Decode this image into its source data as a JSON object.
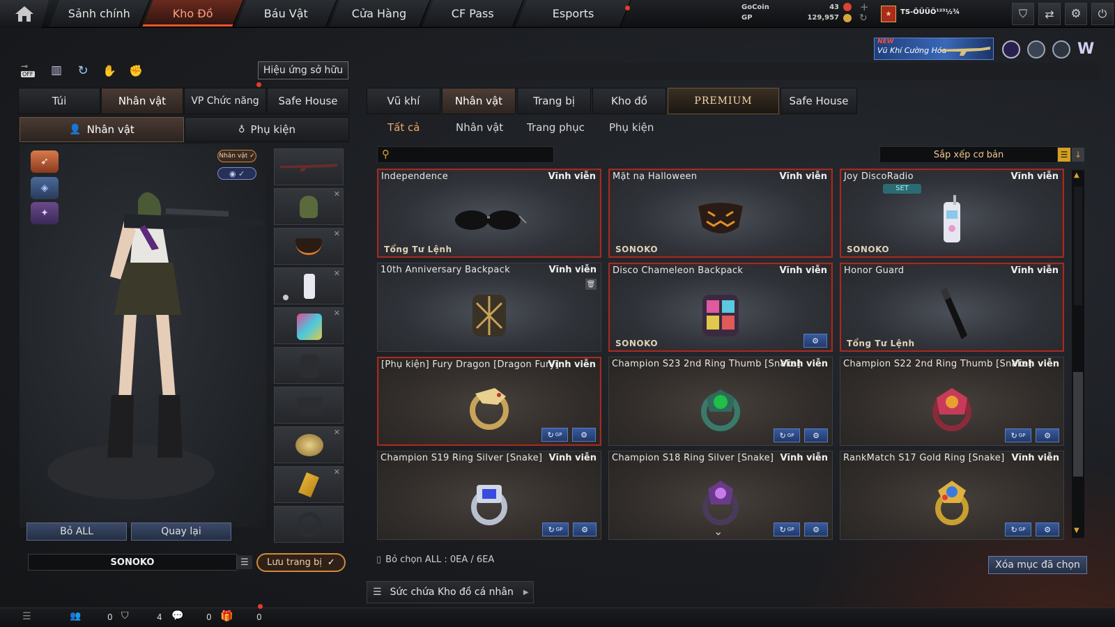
{
  "nav": {
    "tabs": [
      "Sảnh chính",
      "Kho Đồ",
      "Báu Vật",
      "Cửa Hàng",
      "CF Pass",
      "Esports"
    ],
    "active_tab": "Kho Đồ"
  },
  "currency": {
    "gocoin_label": "GoCoin",
    "gocoin_value": "43",
    "gp_label": "GP",
    "gp_value": "129,957"
  },
  "player": {
    "name": "TS-ÕÛÜÖ¹²³½¾"
  },
  "banner": {
    "new": "NEW",
    "text": "Vũ Khí Cường Hóa"
  },
  "left": {
    "off_label": "OFF",
    "effects_button": "Hiệu ứng sở hữu",
    "tabs": [
      "Túi",
      "Nhân vật",
      "VP Chức năng",
      "Safe House"
    ],
    "active_tab": "Nhân vật",
    "subtabs": [
      "Nhân vật",
      "Phụ kiện"
    ],
    "char_badge": "Nhân vật ✓",
    "remove_all": "Bỏ ALL",
    "back": "Quay lại",
    "preset_name": "SONOKO",
    "save_button": "Lưu trang bị"
  },
  "right": {
    "tabs": [
      "Vũ khí",
      "Nhân vật",
      "Trang bị",
      "Kho đồ",
      "PREMIUM",
      "Safe House"
    ],
    "active_tab": "Nhân vật",
    "filters": [
      "Tất cả",
      "Nhân vật",
      "Trang phục",
      "Phụ kiện"
    ],
    "active_filter": "Tất cả",
    "search_placeholder": "",
    "sort_label": "Sắp xếp cơ bản",
    "items": [
      {
        "name": "Independence",
        "duration": "Vĩnh viễn",
        "owner": "Tổng Tư Lệnh",
        "equipped": true,
        "icon": "sunglasses-icon"
      },
      {
        "name": "Mặt nạ Halloween",
        "duration": "Vĩnh viễn",
        "owner": "SONOKO",
        "equipped": true,
        "icon": "halloween-mask-icon"
      },
      {
        "name": "Joy DiscoRadio",
        "duration": "Vĩnh viễn",
        "owner": "SONOKO",
        "equipped": true,
        "set": "SET",
        "icon": "radio-icon"
      },
      {
        "name": "10th Anniversary Backpack",
        "duration": "Vĩnh viễn",
        "owner": "",
        "equipped": false,
        "icon": "backpack-gold-icon"
      },
      {
        "name": "Disco Chameleon Backpack",
        "duration": "Vĩnh viễn",
        "owner": "SONOKO",
        "equipped": true,
        "icon": "backpack-disco-icon"
      },
      {
        "name": "Honor Guard",
        "duration": "Vĩnh viễn",
        "owner": "Tổng Tư Lệnh",
        "equipped": true,
        "icon": "baton-icon"
      },
      {
        "name": "[Phụ kiện] Fury Dragon [Dragon Fury]",
        "duration": "Vĩnh viễn",
        "owner": "",
        "equipped": true,
        "icon": "dragon-ring-icon"
      },
      {
        "name": "Champion S23 2nd Ring Thumb [Snake]",
        "duration": "Vĩnh viễn",
        "owner": "",
        "equipped": false,
        "icon": "emerald-ring-icon"
      },
      {
        "name": "Champion S22 2nd Ring Thumb [Snake]",
        "duration": "Vĩnh viễn",
        "owner": "",
        "equipped": false,
        "icon": "ruby-ring-icon"
      },
      {
        "name": "Champion S19 Ring Silver [Snake]",
        "duration": "Vĩnh viễn",
        "owner": "",
        "equipped": false,
        "icon": "silver-ring-icon"
      },
      {
        "name": "Champion S18 Ring Silver [Snake]",
        "duration": "Vĩnh viễn",
        "owner": "",
        "equipped": false,
        "icon": "purple-ring-icon"
      },
      {
        "name": "RankMatch S17 Gold Ring [Snake]",
        "duration": "Vĩnh viễn",
        "owner": "",
        "equipped": false,
        "icon": "gold-ring-icon"
      }
    ],
    "gp_badge": "GP",
    "deselect_label": "Bỏ chọn ALL : 0EA / 6EA",
    "delete_button": "Xóa mục đã chọn",
    "capacity_label": "Sức chứa Kho đồ cá nhân"
  },
  "footer": {
    "counts": [
      "0",
      "4",
      "0",
      "0"
    ]
  }
}
